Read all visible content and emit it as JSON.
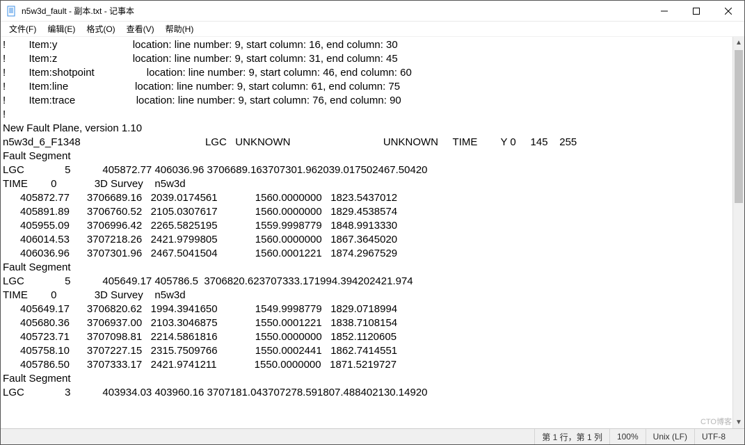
{
  "window": {
    "title": "n5w3d_fault - 副本.txt - 记事本"
  },
  "menu": {
    "file": "文件(F)",
    "edit": "编辑(E)",
    "format": "格式(O)",
    "view": "查看(V)",
    "help": "帮助(H)"
  },
  "body_text": "!        Item:y                          location: line number: 9, start column: 16, end column: 30\n!        Item:z                          location: line number: 9, start column: 31, end column: 45\n!        Item:shotpoint                  location: line number: 9, start column: 46, end column: 60\n!        Item:line                       location: line number: 9, start column: 61, end column: 75\n!        Item:trace                     location: line number: 9, start column: 76, end column: 90\n!\nNew Fault Plane, version 1.10\nn5w3d_6_F1348                                           LGC   UNKNOWN                                UNKNOWN     TIME        Y 0     145    255\nFault Segment\nLGC              5           405872.77 406036.96 3706689.163707301.962039.017502467.50420\nTIME        0             3D Survey    n5w3d\n      405872.77      3706689.16   2039.0174561             1560.0000000   1823.5437012\n      405891.89      3706760.52   2105.0307617             1560.0000000   1829.4538574\n      405955.09      3706996.42   2265.5825195             1559.9998779   1848.9913330\n      406014.53      3707218.26   2421.9799805             1560.0000000   1867.3645020\n      406036.96      3707301.96   2467.5041504             1560.0001221   1874.2967529\nFault Segment\nLGC              5           405649.17 405786.5  3706820.623707333.171994.394202421.974\nTIME        0             3D Survey    n5w3d\n      405649.17      3706820.62   1994.3941650             1549.9998779   1829.0718994\n      405680.36      3706937.00   2103.3046875             1550.0001221   1838.7108154\n      405723.71      3707098.81   2214.5861816             1550.0000000   1852.1120605\n      405758.10      3707227.15   2315.7509766             1550.0002441   1862.7414551\n      405786.50      3707333.17   2421.9741211             1550.0000000   1871.5219727\nFault Segment\nLGC              3           403934.03 403960.16 3707181.043707278.591807.488402130.14920",
  "status": {
    "position": "第 1 行，第 1 列",
    "zoom": "100%",
    "line_ending": "Unix (LF)",
    "encoding": "UTF-8"
  },
  "watermark": "CTO博客"
}
